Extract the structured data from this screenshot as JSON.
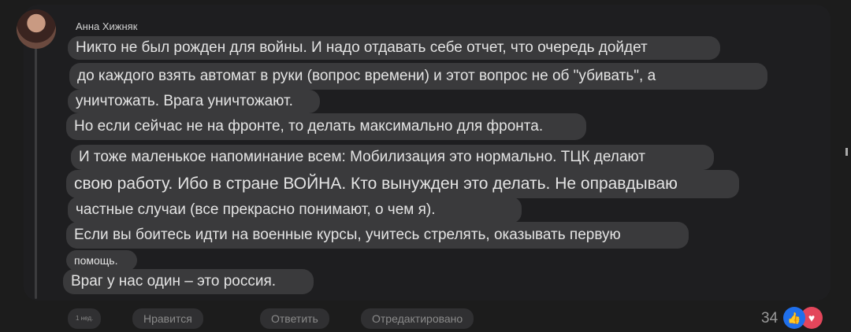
{
  "comment": {
    "author": "Анна Хижняк",
    "lines": [
      "Никто не был рожден для войны. И надо отдавать себе отчет, что очередь дойдет",
      "до каждого взять автомат в руки (вопрос времени) и этот вопрос не об \"убивать\", а",
      "уничтожать. Врага уничтожают.",
      "Но если сейчас не на фронте, то делать максимально для фронта.",
      "И тоже маленькое напоминание всем: Мобилизация это нормально. ТЦК делают",
      "свою работу. Ибо в стране ВОЙНА. Кто вынужден это делать. Не оправдываю",
      "частные случаи (все прекрасно понимают, о чем я).",
      "Если вы боитесь идти на военные курсы, учитесь стрелять, оказывать первую",
      "помощь.",
      "Враг у нас один – это россия."
    ]
  },
  "footer": {
    "time": "1 нед.",
    "like_label": "Нравится",
    "reply_label": "Ответить",
    "edited_label": "Отредактировано",
    "reaction_count": "34"
  },
  "icons": {
    "like": "thumbs-up-icon",
    "heart": "heart-icon"
  },
  "colors": {
    "like": "#1f6feb",
    "heart": "#e3465b",
    "bubble": "#3a3a3c"
  }
}
